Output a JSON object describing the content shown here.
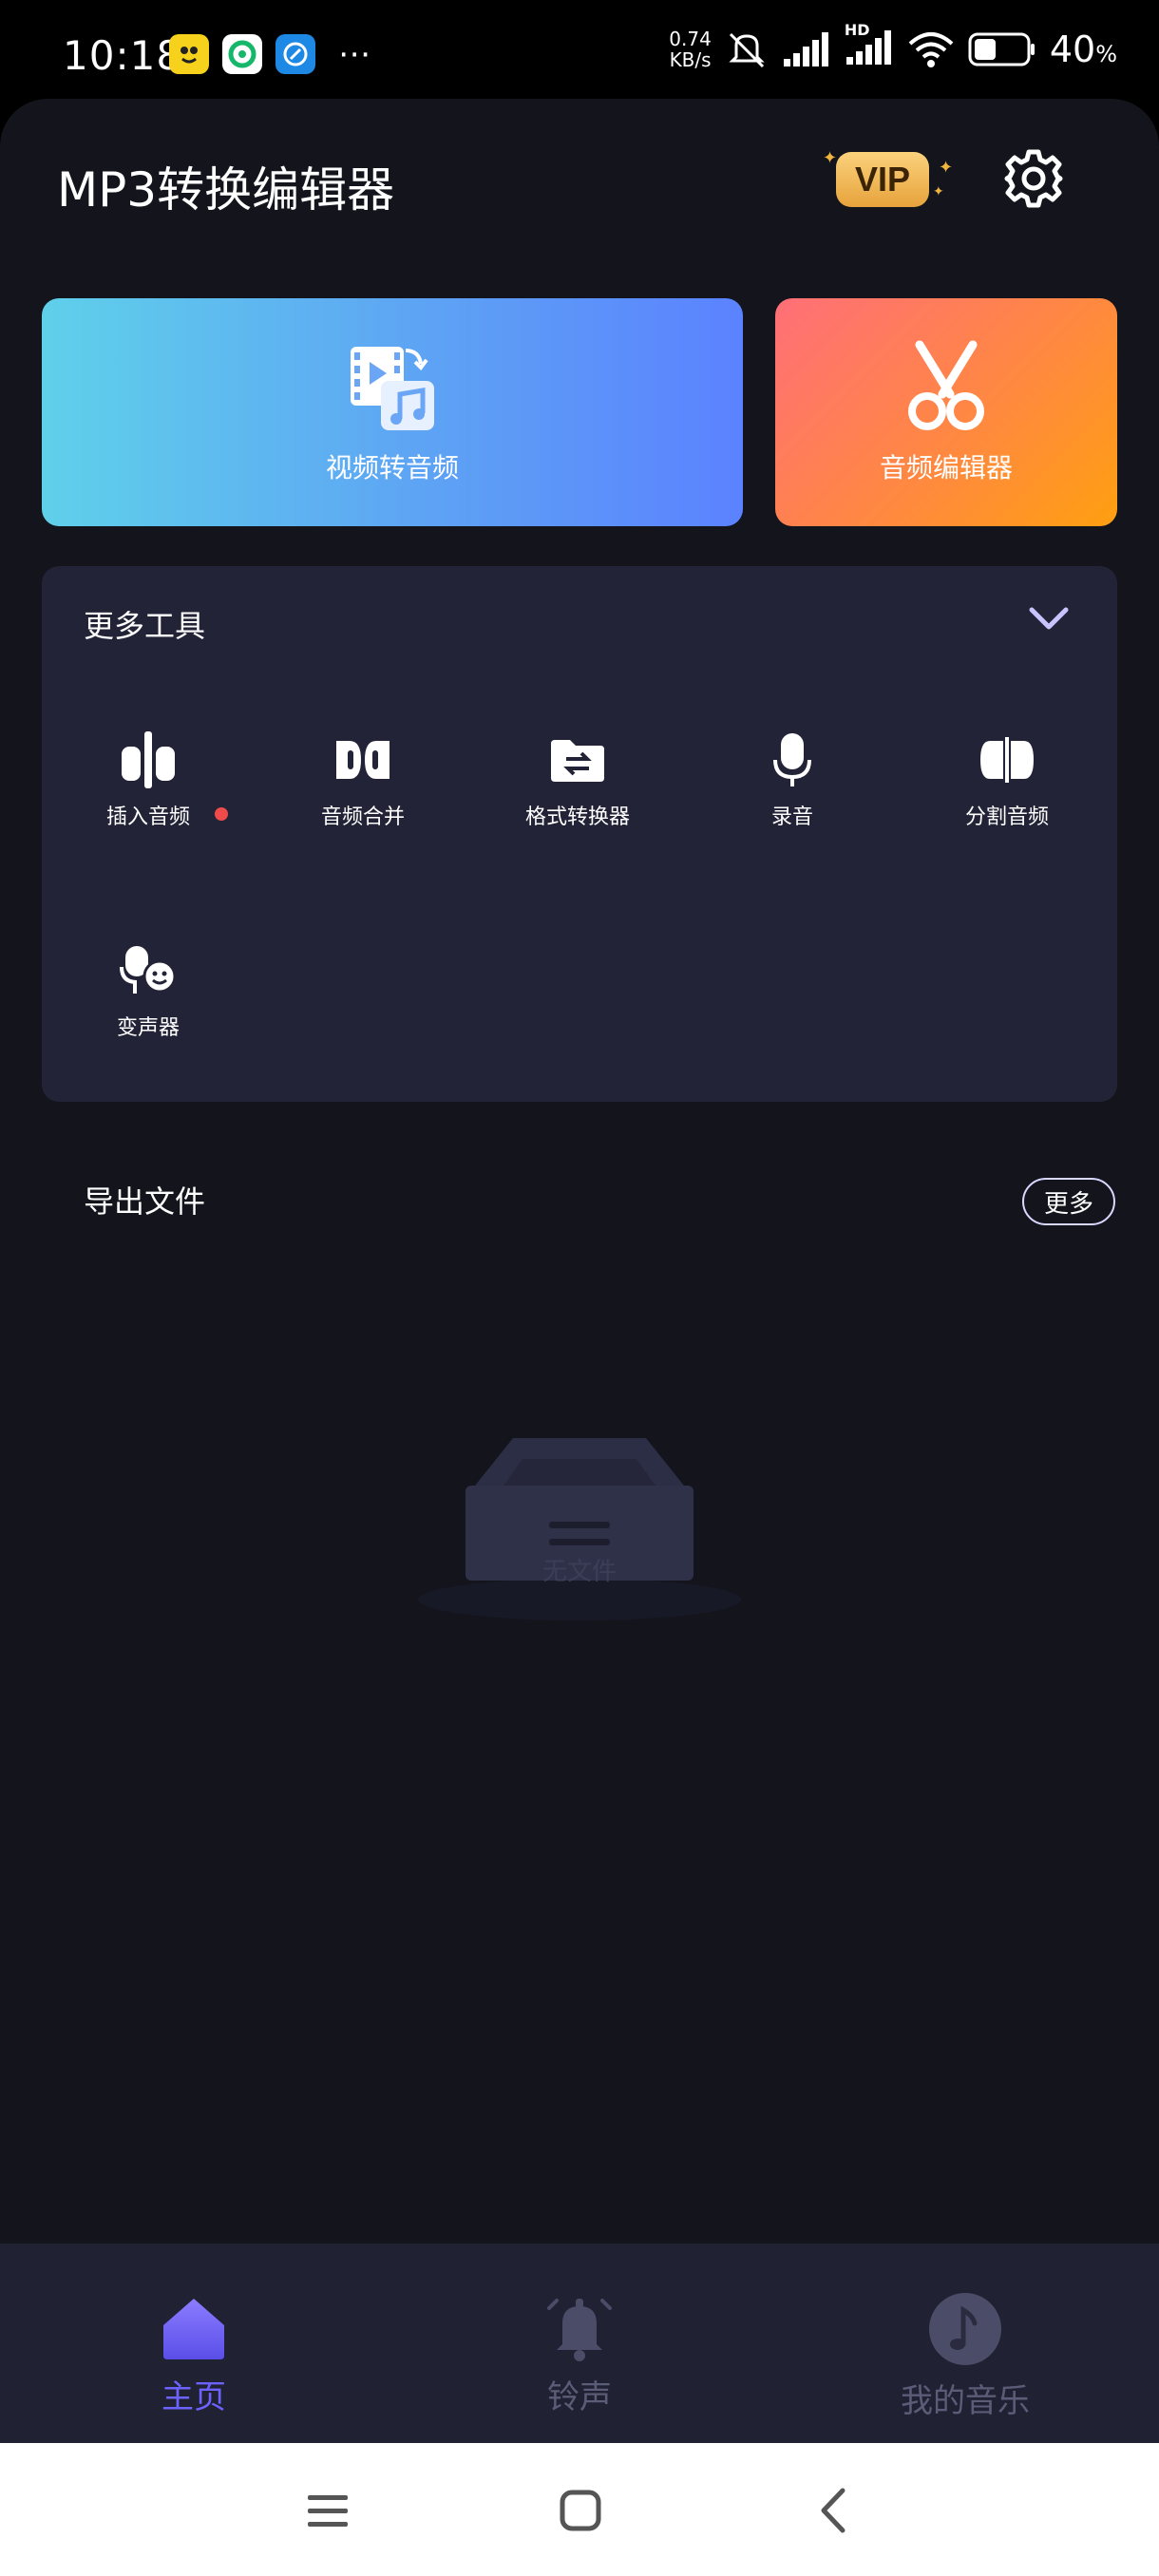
{
  "status_bar": {
    "time": "10:18",
    "speed_value": "0.74",
    "speed_unit": "KB/s",
    "network_badge": "HD",
    "battery_percent": "40",
    "battery_unit": "%"
  },
  "header": {
    "title": "MP3转换编辑器",
    "vip_label": "VIP"
  },
  "cards": {
    "video_to_audio": "视频转音频",
    "audio_editor": "音频编辑器"
  },
  "tools": {
    "title": "更多工具",
    "items": [
      {
        "label": "插入音频",
        "icon": "insert-audio-icon"
      },
      {
        "label": "音频合并",
        "icon": "merge-audio-icon"
      },
      {
        "label": "格式转换器",
        "icon": "format-convert-icon"
      },
      {
        "label": "录音",
        "icon": "microphone-icon"
      },
      {
        "label": "分割音频",
        "icon": "split-audio-icon"
      },
      {
        "label": "变声器",
        "icon": "voice-changer-icon"
      }
    ]
  },
  "export": {
    "title": "导出文件",
    "more_label": "更多",
    "empty_text": "无文件"
  },
  "bottom_nav": {
    "items": [
      {
        "label": "主页",
        "active": true
      },
      {
        "label": "铃声",
        "active": false
      },
      {
        "label": "我的音乐",
        "active": false
      }
    ]
  },
  "colors": {
    "accent": "#6c63ff",
    "background": "#13141c",
    "panel": "#222336",
    "vip_gold": "#f0b53f"
  }
}
